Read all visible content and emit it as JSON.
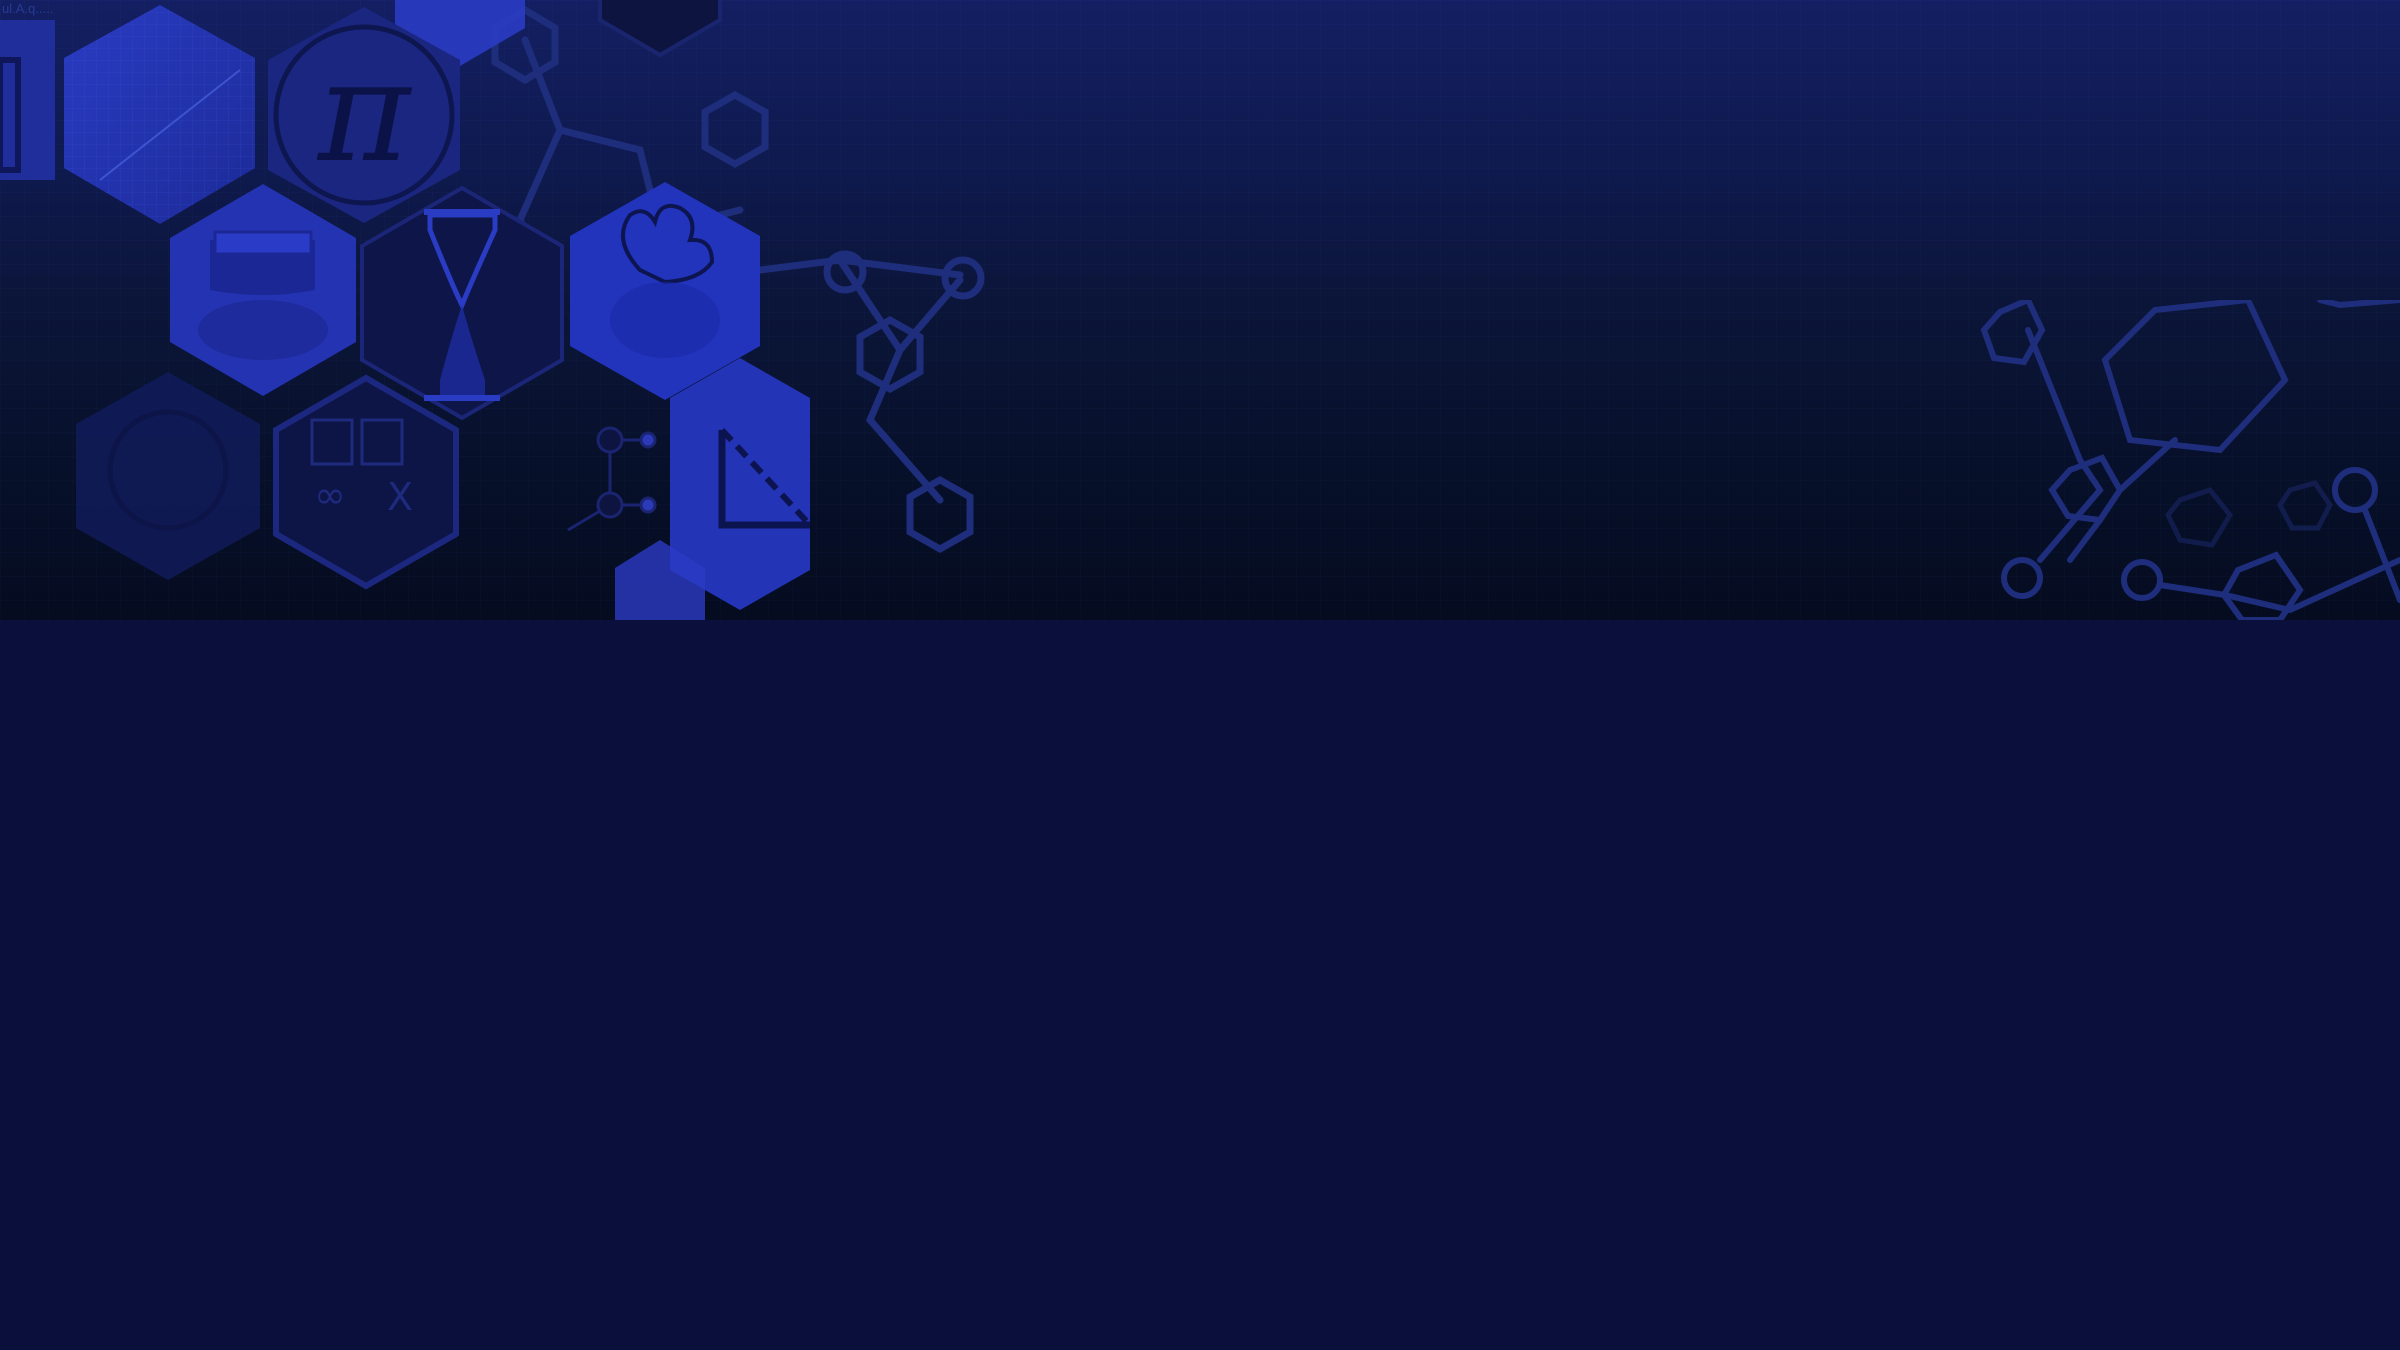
{
  "hero": {
    "corner_caption": "ul.A.q.....",
    "pi_symbol": "π",
    "infinity_symbol": "∞",
    "times_symbol": "X"
  },
  "colors": {
    "page_background": "#0a0f3c",
    "banner_top": "#131f62",
    "banner_bottom": "#050c20",
    "hex_bright": "#2636b8",
    "hex_dim": "#1a2570",
    "molecule_line": "#1e2e7c"
  },
  "icons": [
    "pi-icon",
    "graph-paper-icon",
    "bell-icon",
    "hourglass-icon",
    "brain-tree-icon",
    "calculator-icon",
    "triangle-ruler-icon",
    "molecule-icon"
  ]
}
